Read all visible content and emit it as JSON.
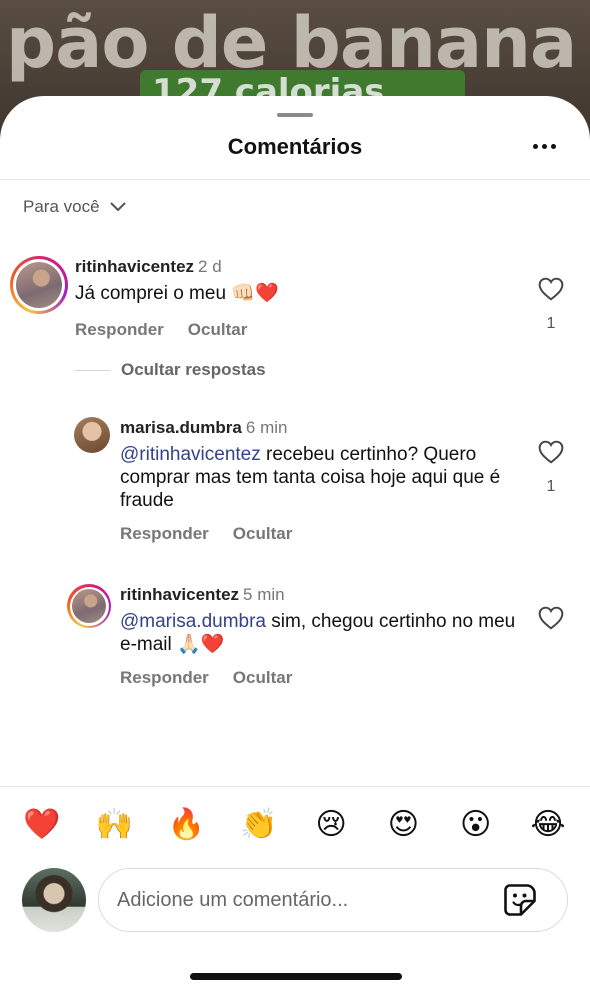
{
  "background": {
    "title": "pão de banana",
    "subtitle": "127 calorias"
  },
  "header": {
    "title": "Comentários",
    "more_icon": "more-horizontal-icon"
  },
  "filter": {
    "label": "Para você",
    "icon": "chevron-down-icon"
  },
  "comments": [
    {
      "username": "ritinhavicentez",
      "time": "2 d",
      "text": "Já comprei o meu 👊🏻❤️",
      "reply_label": "Responder",
      "hide_label": "Ocultar",
      "likes": "1",
      "has_story_ring": true
    }
  ],
  "hide_replies_label": "Ocultar respostas",
  "replies": [
    {
      "username": "marisa.dumbra",
      "time": "6 min",
      "mention": "@ritinhavicentez",
      "text": " recebeu certinho? Quero comprar mas tem tanta coisa hoje aqui que é fraude",
      "reply_label": "Responder",
      "hide_label": "Ocultar",
      "likes": "1",
      "has_story_ring": false
    },
    {
      "username": "ritinhavicentez",
      "time": "5 min",
      "mention": "@marisa.dumbra",
      "text": " sim, chegou certinho no meu e-mail 🙏🏻❤️",
      "reply_label": "Responder",
      "hide_label": "Ocultar",
      "likes": "",
      "has_story_ring": true
    }
  ],
  "quick_reactions": [
    "❤️",
    "🙌",
    "🔥",
    "👏",
    "😢",
    "😍",
    "😮",
    "😂"
  ],
  "composer": {
    "placeholder": "Adicione um comentário...",
    "sticker_icon": "sticker-icon"
  },
  "colors": {
    "mention": "#35428a",
    "heart": "#e0252a",
    "story_ring_start": "#f9c33c",
    "story_ring_end": "#a21fbf"
  }
}
